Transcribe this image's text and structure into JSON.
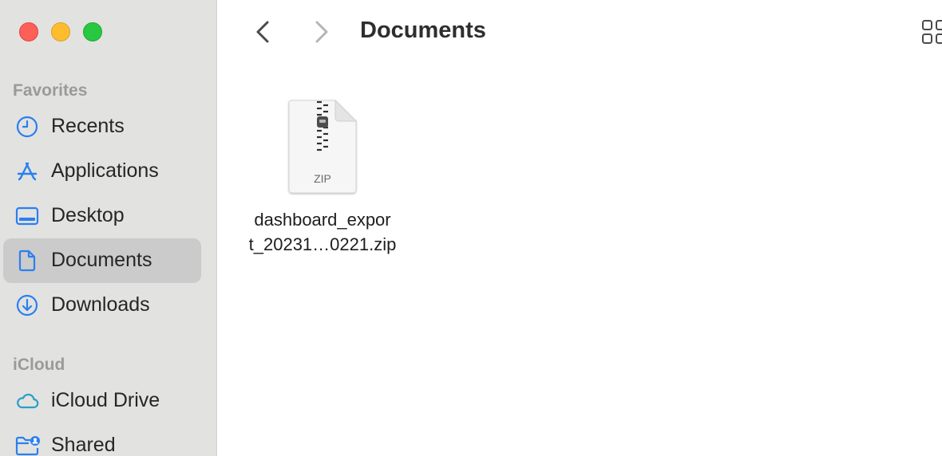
{
  "window": {
    "title": "Documents"
  },
  "sidebar": {
    "sections": [
      {
        "title": "Favorites",
        "items": [
          {
            "label": "Recents",
            "icon": "clock-icon"
          },
          {
            "label": "Applications",
            "icon": "applications-icon"
          },
          {
            "label": "Desktop",
            "icon": "desktop-icon"
          },
          {
            "label": "Documents",
            "icon": "document-icon",
            "selected": true
          },
          {
            "label": "Downloads",
            "icon": "downloads-icon"
          }
        ]
      },
      {
        "title": "iCloud",
        "items": [
          {
            "label": "iCloud Drive",
            "icon": "cloud-icon"
          },
          {
            "label": "Shared",
            "icon": "shared-folder-icon"
          }
        ]
      }
    ]
  },
  "files": [
    {
      "name_line1": "dashboard_expor",
      "name_line2": "t_20231…0221.zip",
      "type_label": "ZIP",
      "icon": "zip-file-icon"
    }
  ],
  "colors": {
    "sidebar_bg": "#e2e2e1",
    "selection_bg": "#cbcbcb",
    "accent_icon": "#2a7ff0",
    "close": "#fe5f57",
    "minimize": "#febc2e",
    "maximize": "#28c840"
  }
}
